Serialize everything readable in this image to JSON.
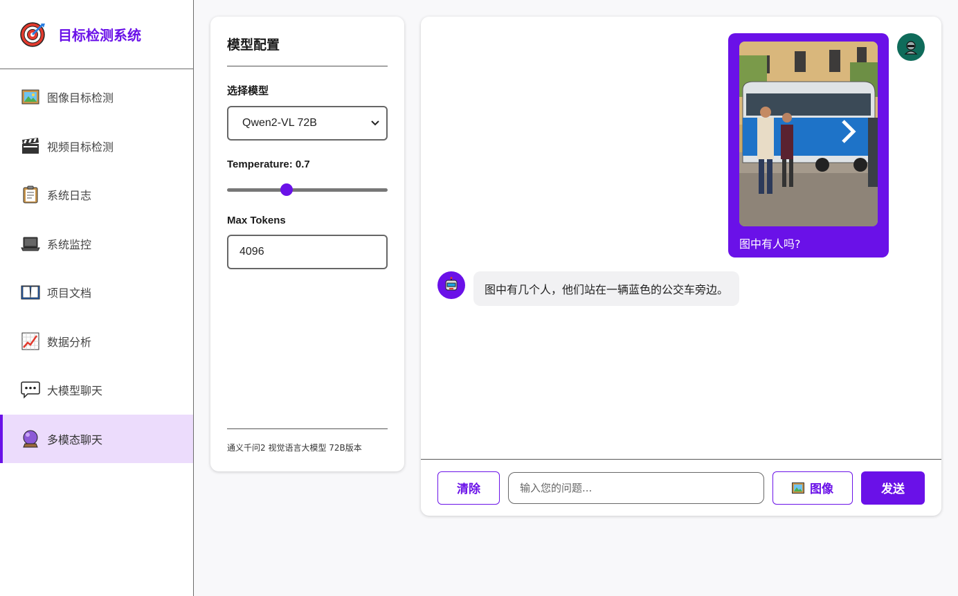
{
  "brand": {
    "title": "目标检测系统",
    "icon": "target-icon"
  },
  "sidebar": {
    "items": [
      {
        "label": "图像目标检测",
        "icon": "picture-icon"
      },
      {
        "label": "视频目标检测",
        "icon": "clapperboard-icon"
      },
      {
        "label": "系统日志",
        "icon": "clipboard-icon"
      },
      {
        "label": "系统监控",
        "icon": "laptop-icon"
      },
      {
        "label": "项目文档",
        "icon": "book-icon"
      },
      {
        "label": "数据分析",
        "icon": "chart-icon"
      },
      {
        "label": "大模型聊天",
        "icon": "speech-bubble-icon"
      },
      {
        "label": "多模态聊天",
        "icon": "crystal-ball-icon",
        "active": true
      }
    ]
  },
  "config": {
    "title": "模型配置",
    "model_label": "选择模型",
    "model_value": "Qwen2-VL 72B",
    "temperature_label": "Temperature:",
    "temperature_value": "0.7",
    "temperature_fraction": 0.37,
    "max_tokens_label": "Max Tokens",
    "max_tokens_value": "4096",
    "footer": "通义千问2 视觉语言大模型 72B版本"
  },
  "chat": {
    "messages": [
      {
        "role": "user",
        "text": "图中有人吗?",
        "has_image": true
      },
      {
        "role": "assistant",
        "text": "图中有几个人，他们站在一辆蓝色的公交车旁边。"
      }
    ],
    "clear_label": "清除",
    "input_placeholder": "输入您的问题...",
    "image_label": "图像",
    "send_label": "发送"
  },
  "colors": {
    "accent": "#6a11e8",
    "active_bg": "#ecdcfc",
    "user_avatar": "#0f6b5a"
  }
}
